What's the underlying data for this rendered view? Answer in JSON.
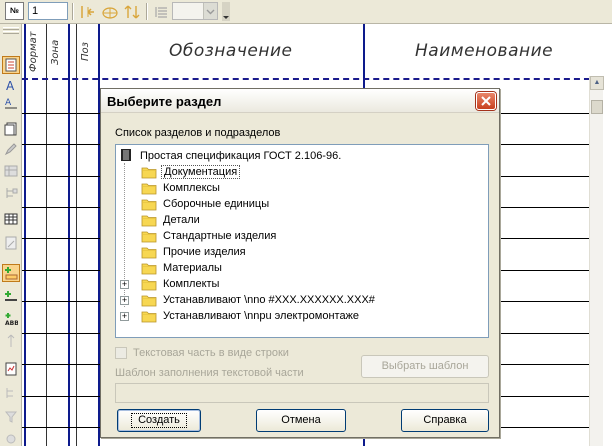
{
  "toolbar": {
    "number_icon_label": "№",
    "number_value": "1"
  },
  "sheet": {
    "headers": {
      "format": "Формат",
      "zone": "Зона",
      "pos": "Поз",
      "designation": "Обозначение",
      "name": "Наименование"
    }
  },
  "dialog": {
    "title": "Выберите раздел",
    "list_label": "Список разделов и подразделов",
    "root": "Простая спецификация ГОСТ 2.106-96.",
    "items": [
      {
        "label": "Документация",
        "expandable": false,
        "selected": true
      },
      {
        "label": "Комплексы",
        "expandable": false,
        "selected": false
      },
      {
        "label": "Сборочные единицы",
        "expandable": false,
        "selected": false
      },
      {
        "label": "Детали",
        "expandable": false,
        "selected": false
      },
      {
        "label": "Стандартные изделия",
        "expandable": false,
        "selected": false
      },
      {
        "label": "Прочие изделия",
        "expandable": false,
        "selected": false
      },
      {
        "label": "Материалы",
        "expandable": false,
        "selected": false
      },
      {
        "label": "Комплекты",
        "expandable": true,
        "selected": false
      },
      {
        "label": "Устанавливают \\nno #XXX.XXXXXX.XXX#",
        "expandable": true,
        "selected": false
      },
      {
        "label": "Устанавливают \\nnpu электромонтаже",
        "expandable": true,
        "selected": false
      }
    ],
    "checkbox_label": "Текстовая часть в виде строки",
    "template_label": "Шаблон заполнения текстовой части",
    "template_value": "",
    "pick_template_button": "Выбрать шаблон",
    "create_button": "Создать",
    "cancel_button": "Отмена",
    "help_button": "Справка"
  }
}
